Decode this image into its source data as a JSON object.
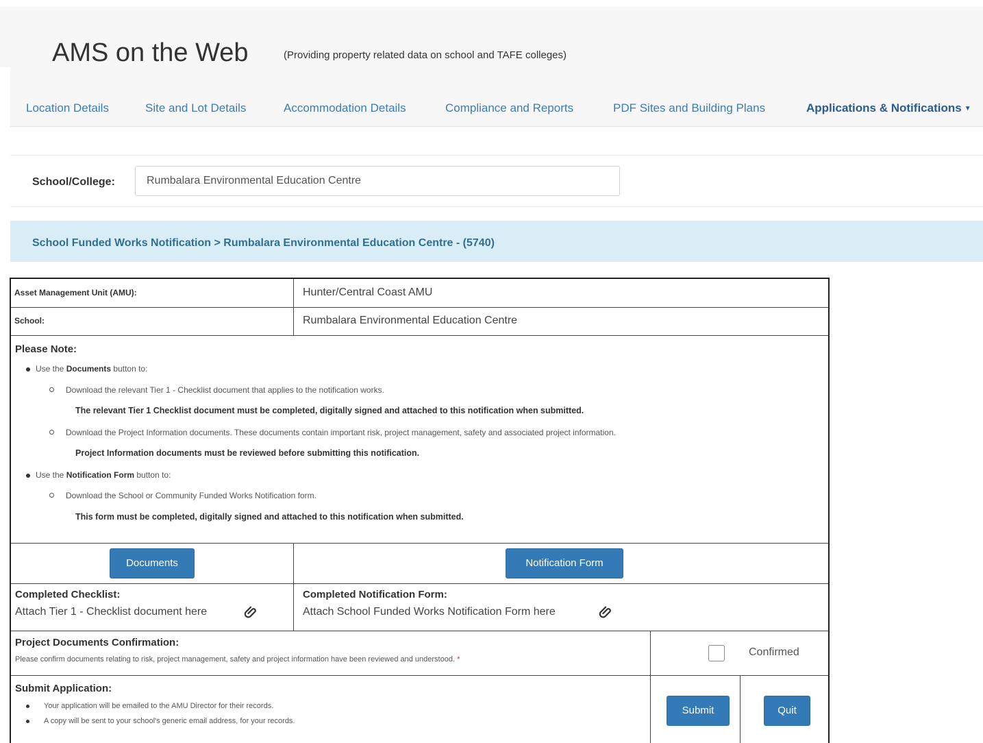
{
  "header": {
    "top_cut_text": "",
    "app_title": "AMS on the Web",
    "app_subtitle": "(Providing property related data on school and TAFE colleges)"
  },
  "nav": {
    "items": [
      {
        "label": "Location Details"
      },
      {
        "label": "Site and Lot Details"
      },
      {
        "label": "Accommodation Details"
      },
      {
        "label": "Compliance and Reports"
      },
      {
        "label": "PDF Sites and Building Plans"
      },
      {
        "label": "Applications & Notifications"
      }
    ]
  },
  "selector": {
    "label": "School/College:",
    "value": "Rumbalara Environmental Education Centre"
  },
  "breadcrumb": "School Funded Works Notification  >  Rumbalara Environmental Education Centre - (5740)",
  "form": {
    "amu_label": "Asset Management Unit (AMU):",
    "amu_value": "Hunter/Central Coast AMU",
    "school_label": "School:",
    "school_value": "Rumbalara Environmental Education Centre",
    "note_title": "Please Note:",
    "notes": {
      "b1_pre": "Use the ",
      "b1_bold": "Documents",
      "b1_post": " button to:",
      "s1": "Download the relevant Tier 1 - Checklist document that applies to the notification works.",
      "s1_bold": "The relevant Tier 1 Checklist document must be completed, digitally signed and attached to this notification when submitted.",
      "s2": "Download the Project Information documents. These documents contain important risk, project management, safety and associated project information.",
      "s2_bold": "Project Information documents must be reviewed before submitting this notification.",
      "b2_pre": "Use the ",
      "b2_bold": "Notification Form",
      "b2_post": " button to:",
      "s3": "Download the School or Community Funded Works Notification form.",
      "s3_bold": "This form must be completed, digitally signed and attached to this notification when submitted."
    },
    "documents_button": "Documents",
    "notification_button": "Notification Form",
    "checklist_title": "Completed Checklist:",
    "checklist_text": "Attach Tier 1 - Checklist document here",
    "notif_title": "Completed Notification Form:",
    "notif_text": "Attach School Funded Works Notification Form here",
    "confirm_title": "Project Documents Confirmation:",
    "confirm_text": "Please confirm documents relating to risk, project management, safety and project information have been reviewed and understood.",
    "confirm_required": "*",
    "confirm_label": "Confirmed",
    "submit_title": "Submit Application:",
    "submit_b1": "Your application will be emailed to the AMU Director for their records.",
    "submit_b2": "A copy will be sent to your school's generic email address, for your records.",
    "submit_button": "Submit",
    "quit_button": "Quit"
  },
  "colors": {
    "link": "#3c7cb5",
    "button": "#337ab7",
    "breadcrumb_bg": "#d9edf7",
    "breadcrumb_text": "#31708f"
  }
}
